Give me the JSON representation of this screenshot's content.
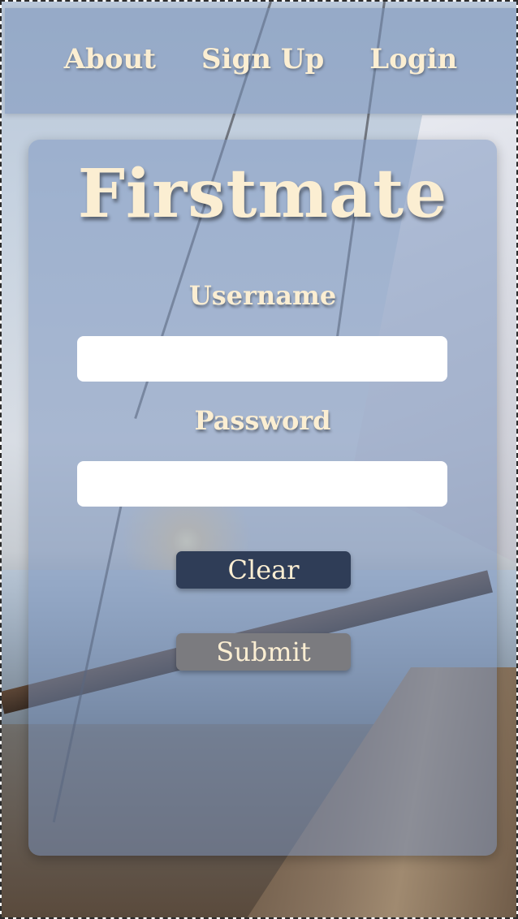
{
  "nav": {
    "items": [
      {
        "label": "About"
      },
      {
        "label": "Sign Up"
      },
      {
        "label": "Login"
      }
    ]
  },
  "card": {
    "brand": "Firstmate",
    "username_label": "Username",
    "username_value": "",
    "password_label": "Password",
    "password_value": "",
    "clear_label": "Clear",
    "submit_label": "Submit"
  },
  "colors": {
    "text_cream": "#fbeed2",
    "clear_button": "#2f3d57",
    "submit_button": "#7b7b7f",
    "overlay_blue": "#7891b9"
  }
}
